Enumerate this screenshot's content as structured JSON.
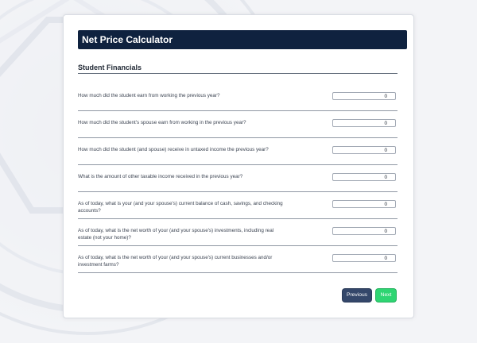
{
  "header": {
    "title": "Net Price Calculator"
  },
  "section": {
    "title": "Student Financials"
  },
  "questions": [
    {
      "label": "How much did the student earn from working the previous year?",
      "value": "0"
    },
    {
      "label": "How much did the student's spouse earn from working in the previous year?",
      "value": "0"
    },
    {
      "label": "How much did the student (and spouse) receive in untaxed income the previous year?",
      "value": "0"
    },
    {
      "label": "What is the amount of other taxable income received in the previous year?",
      "value": "0"
    },
    {
      "label": "As of today, what is your (and your spouse's) current balance of cash, savings, and checking accounts?",
      "value": "0"
    },
    {
      "label": "As of today, what is the net worth of your (and your spouse's) investments, including real estate (not your home)?",
      "value": "0"
    },
    {
      "label": "As of today, what is the net worth of your (and your spouse's) current businesses and/or investment farms?",
      "value": "0"
    }
  ],
  "buttons": {
    "previous_label": "Previous",
    "next_label": "Next"
  },
  "colors": {
    "banner": "#0f223f",
    "previous_button": "#34476a",
    "next_button": "#2ed572"
  }
}
